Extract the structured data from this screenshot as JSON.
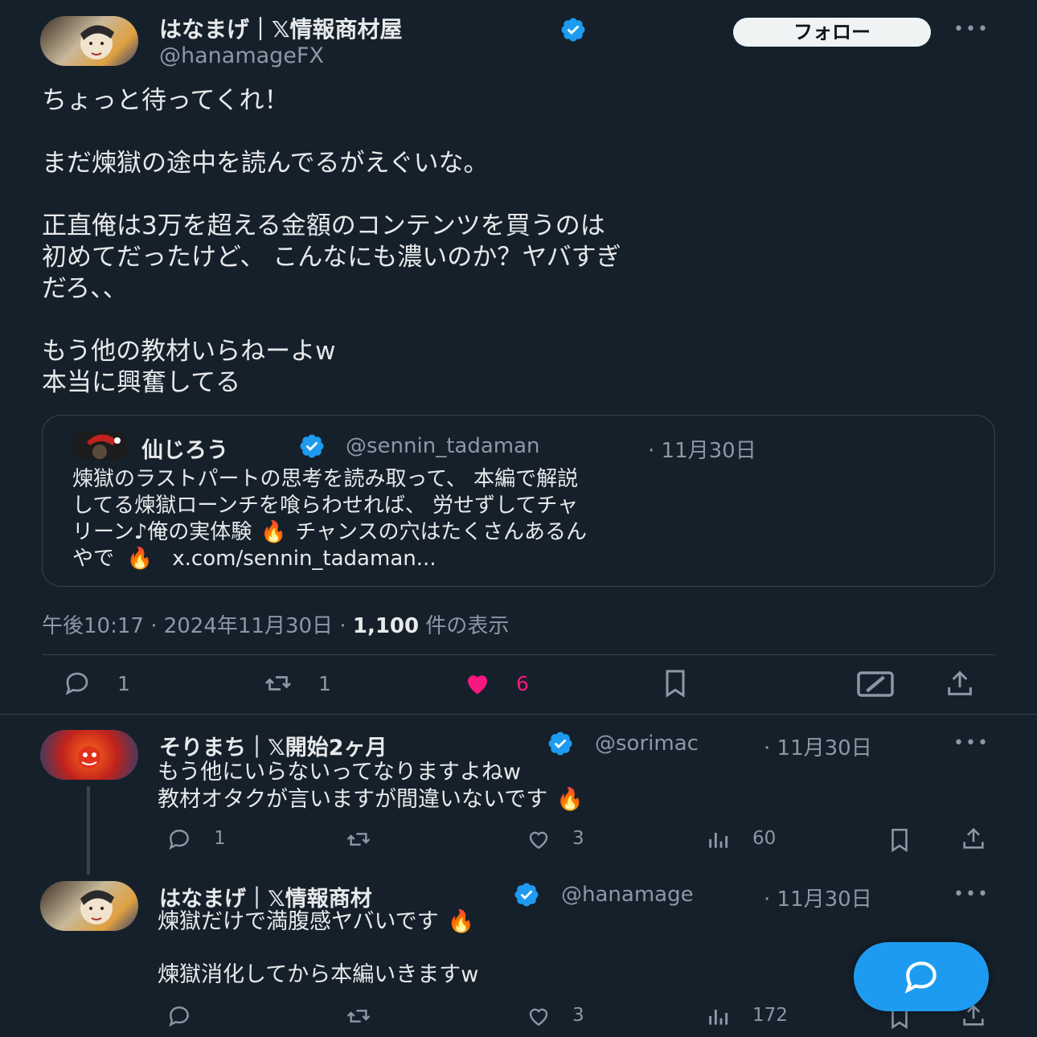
{
  "main": {
    "author_name": "はなまげ｜𝕏情報商材屋",
    "author_handle": "@hanamageFX",
    "follow_label": "フォロー",
    "more": "•••",
    "body_lines": [
      "ちょっと待ってくれ！",
      "まだ煉獄の途中を読んでるがえぐいな。",
      "正直俺は3万を超える金額のコンテンツを買うのは",
      "初めてだったけど、 こんなにも濃いのか？ヤバすぎ",
      "だろ、、",
      "もう他の教材いらねーよw",
      "本当に興奮してる"
    ],
    "quote": {
      "name": "仙じろう",
      "handle": "@sennin_tadaman",
      "date": "· 11月30日",
      "lines": [
        "煉獄のラストパートの思考を読み取って、 本編で解説",
        "してる煉獄ローンチを喰らわせれば、 労せずしてチャ",
        "リーン♪俺の実体験",
        "チャンスの穴はたくさんあるん",
        "やで",
        "x.com/sennin_tadaman..."
      ]
    },
    "meta_time": "午後10:17 · 2024年11月30日 ·",
    "views_count": "1,100",
    "views_label": "件の表示",
    "actions": {
      "reply": "1",
      "retweet": "1",
      "like": "6"
    }
  },
  "replies": [
    {
      "name": "そりまち｜𝕏開始2ヶ月",
      "handle": "@sorimac",
      "date": "· 11月30日",
      "more": "•••",
      "lines": [
        "もう他にいらないってなりますよねw",
        "教材オタクが言いますが間違いないです"
      ],
      "reply": "1",
      "retweet": "",
      "like": "3",
      "views": "60"
    },
    {
      "name": "はなまげ｜𝕏情報商材",
      "handle": "@hanamage",
      "date": "· 11月30日",
      "more": "•••",
      "lines": [
        "煉獄だけで満腹感ヤバいです",
        "煉獄消化してから本編いきますw"
      ],
      "reply": "",
      "retweet": "",
      "like": "3",
      "views": "172"
    }
  ],
  "colors": {
    "background": "#15202b",
    "text": "#e7e9ea",
    "muted": "#8b98a5",
    "accent": "#1d9bf0",
    "like": "#f91880"
  },
  "icons": [
    "verified-badge-icon",
    "reply-icon",
    "retweet-icon",
    "heart-icon",
    "bookmark-icon",
    "grok-icon",
    "share-icon",
    "views-icon",
    "fire-emoji-icon",
    "compose-icon"
  ]
}
